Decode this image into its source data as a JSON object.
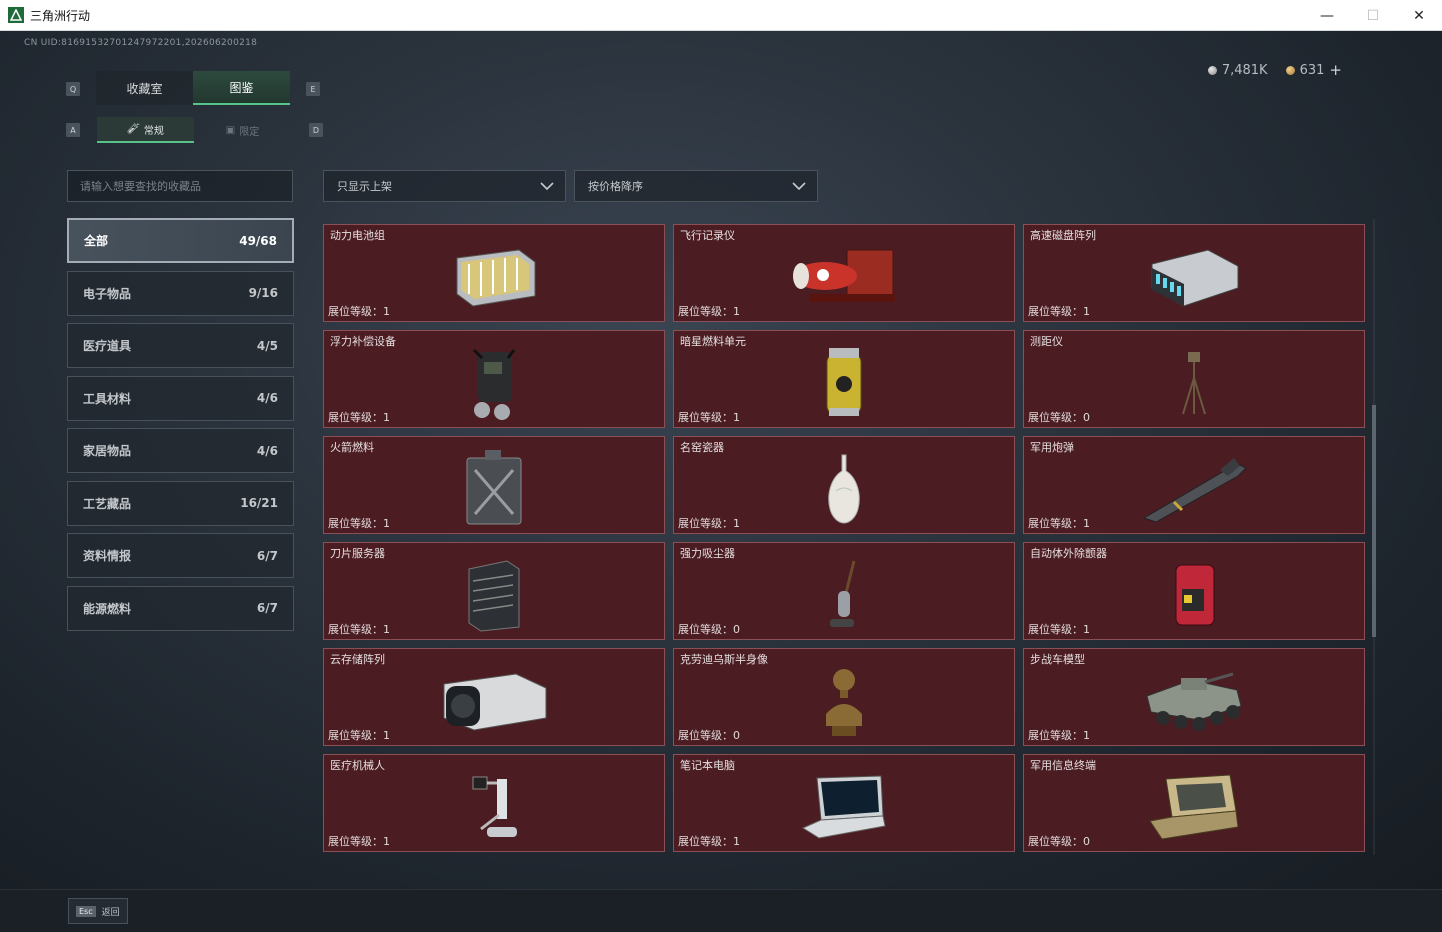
{
  "window": {
    "title": "三角洲行动",
    "minimize": "—",
    "maximize": "☐",
    "close": "✕"
  },
  "uid": "CN UID:81691532701247972201,202606200218",
  "currency": {
    "silver": "7,481K",
    "gold": "631",
    "plus": "+"
  },
  "key_hints": {
    "q": "Q",
    "e": "E",
    "a": "A",
    "d": "D"
  },
  "tabs": {
    "collection": "收藏室",
    "catalog": "图鉴",
    "normal": "常规",
    "limited": "限定"
  },
  "search": {
    "placeholder": "请输入想要查找的收藏品"
  },
  "filters": {
    "listing": "只显示上架",
    "sort": "按价格降序"
  },
  "categories": [
    {
      "label": "全部",
      "count": "49/68"
    },
    {
      "label": "电子物品",
      "count": "9/16"
    },
    {
      "label": "医疗道具",
      "count": "4/5"
    },
    {
      "label": "工具材料",
      "count": "4/6"
    },
    {
      "label": "家居物品",
      "count": "4/6"
    },
    {
      "label": "工艺藏品",
      "count": "16/21"
    },
    {
      "label": "资料情报",
      "count": "6/7"
    },
    {
      "label": "能源燃料",
      "count": "6/7"
    }
  ],
  "items": [
    {
      "name": "动力电池组",
      "level": "展位等级：1",
      "icon": "battery-pack-icon"
    },
    {
      "name": "飞行记录仪",
      "level": "展位等级：1",
      "icon": "flight-recorder-icon"
    },
    {
      "name": "高速磁盘阵列",
      "level": "展位等级：1",
      "icon": "disk-array-icon"
    },
    {
      "name": "浮力补偿设备",
      "level": "展位等级：1",
      "icon": "buoyancy-device-icon"
    },
    {
      "name": "暗星燃料单元",
      "level": "展位等级：1",
      "icon": "fuel-cell-icon"
    },
    {
      "name": "测距仪",
      "level": "展位等级：0",
      "icon": "rangefinder-icon"
    },
    {
      "name": "火箭燃料",
      "level": "展位等级：1",
      "icon": "rocket-fuel-icon"
    },
    {
      "name": "名窑瓷器",
      "level": "展位等级：1",
      "icon": "porcelain-vase-icon"
    },
    {
      "name": "军用炮弹",
      "level": "展位等级：1",
      "icon": "artillery-shell-icon"
    },
    {
      "name": "刀片服务器",
      "level": "展位等级：1",
      "icon": "blade-server-icon"
    },
    {
      "name": "强力吸尘器",
      "level": "展位等级：0",
      "icon": "vacuum-cleaner-icon"
    },
    {
      "name": "自动体外除颤器",
      "level": "展位等级：1",
      "icon": "defibrillator-icon"
    },
    {
      "name": "云存储阵列",
      "level": "展位等级：1",
      "icon": "cloud-storage-icon"
    },
    {
      "name": "克劳迪乌斯半身像",
      "level": "展位等级：0",
      "icon": "bust-statue-icon"
    },
    {
      "name": "步战车模型",
      "level": "展位等级：1",
      "icon": "ifv-model-icon"
    },
    {
      "name": "医疗机械人",
      "level": "展位等级：1",
      "icon": "medical-robot-icon"
    },
    {
      "name": "笔记本电脑",
      "level": "展位等级：1",
      "icon": "laptop-icon"
    },
    {
      "name": "军用信息终端",
      "level": "展位等级：0",
      "icon": "military-terminal-icon"
    }
  ],
  "footer": {
    "esc_key": "Esc",
    "back": "返回"
  }
}
